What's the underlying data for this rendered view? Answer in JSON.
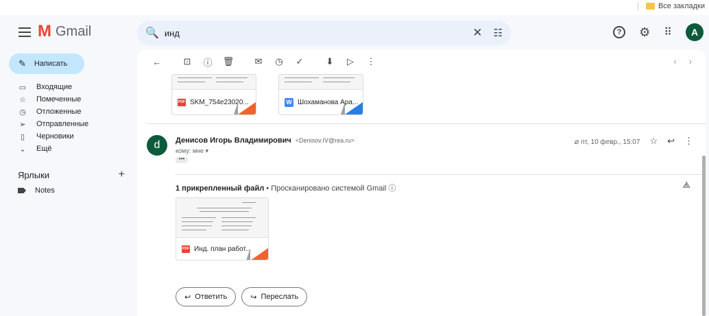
{
  "bookmarks": {
    "all_label": "Все закладки"
  },
  "app": {
    "title": "Gmail",
    "logo_letter": "M"
  },
  "search": {
    "query": "инд",
    "clear_glyph": "✕",
    "filter_glyph": "☷",
    "icon_glyph": "🔍"
  },
  "topbar": {
    "help_glyph": "?",
    "settings_glyph": "⚙",
    "apps_glyph": "⠿",
    "avatar_letter": "A"
  },
  "compose": {
    "label": "Написать",
    "icon_glyph": "✎"
  },
  "nav": {
    "items": [
      {
        "label": "Входящие",
        "icon": "▭"
      },
      {
        "label": "Помеченные",
        "icon": "☆"
      },
      {
        "label": "Отложенные",
        "icon": "◷"
      },
      {
        "label": "Отправленные",
        "icon": "➢"
      },
      {
        "label": "Черновики",
        "icon": "▯"
      },
      {
        "label": "Ещё",
        "icon": "⌄"
      }
    ]
  },
  "labels": {
    "heading": "Ярлыки",
    "add_glyph": "+",
    "items": [
      {
        "label": "Notes"
      }
    ]
  },
  "toolbar": {
    "back": "←",
    "archive": "⊡",
    "report": "ⓘ",
    "delete": "🗑",
    "mark_unread": "✉",
    "snooze": "◷",
    "add_task": "✓",
    "move": "⬇",
    "label": "▷",
    "more": "⋮",
    "prev": "‹",
    "next": "›"
  },
  "prev_attachments": [
    {
      "name": "SKM_754e23020...",
      "type": "PDF"
    },
    {
      "name": "Шохаманова Ара...",
      "type": "W"
    }
  ],
  "message": {
    "avatar_letter": "d",
    "sender_name": "Денисов Игорь Владимирович",
    "sender_email": "<Denisov.IV@rea.ru>",
    "to": "кому: мне ▾",
    "dots": "•••",
    "date": "пт, 10 февр., 15:07",
    "clip_glyph": "⌀",
    "star_glyph": "☆",
    "reply_glyph": "↩",
    "more_glyph": "⋮"
  },
  "attachments": {
    "count_label": "1 прикрепленный файл",
    "scan_label": " • Просканировано системой Gmail ⓘ",
    "drive_glyph": "⟁",
    "items": [
      {
        "name": "Инд. план работ...",
        "type": "PDF"
      }
    ]
  },
  "actions": {
    "reply": {
      "label": "Ответить",
      "glyph": "↩"
    },
    "forward": {
      "label": "Переслать",
      "glyph": "↪"
    }
  }
}
